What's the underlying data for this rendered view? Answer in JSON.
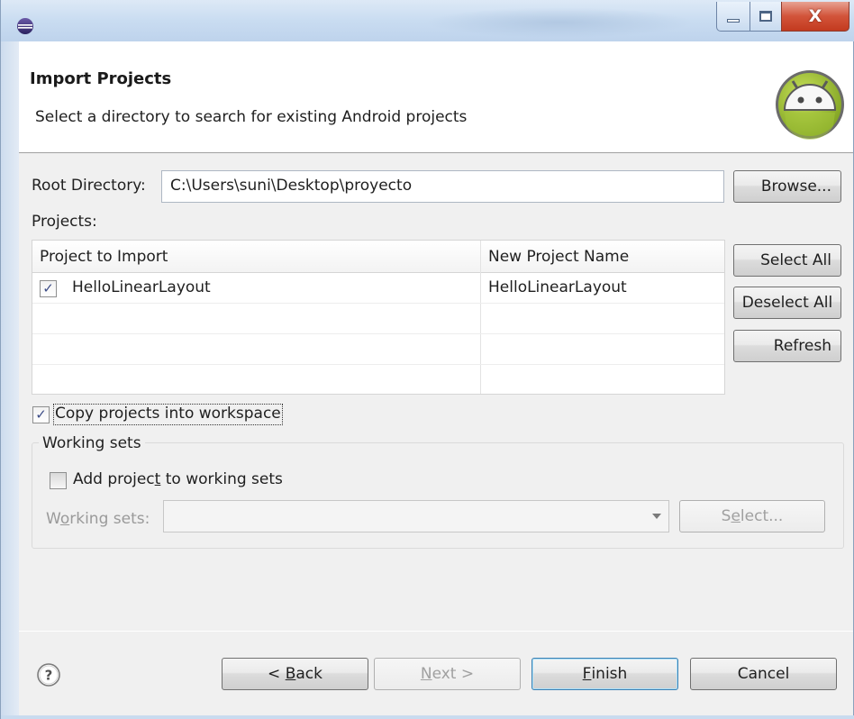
{
  "window": {
    "controls": {
      "minimize_icon": "minimize-icon",
      "maximize_icon": "maximize-icon",
      "close_glyph": "X"
    }
  },
  "header": {
    "title": "Import Projects",
    "description": "Select a directory to search for existing Android projects",
    "logo_icon": "android-logo"
  },
  "root_directory": {
    "label": "Root Directory:",
    "value": "C:\\Users\\suni\\Desktop\\proyecto",
    "browse_label": "Browse..."
  },
  "projects": {
    "label": "Projects:",
    "columns": [
      "Project to Import",
      "New Project Name"
    ],
    "rows": [
      {
        "checked": true,
        "project": "HelloLinearLayout",
        "new_name": "HelloLinearLayout"
      }
    ],
    "buttons": {
      "select_all": "Select All",
      "deselect_all": "Deselect All",
      "refresh": "Refresh"
    }
  },
  "copy_projects": {
    "label": "Copy projects into workspace",
    "checked": true
  },
  "working_sets": {
    "group_label": "Working sets",
    "add_label_pre": "Add projec",
    "add_label_mnemonic": "t",
    "add_label_post": " to working sets",
    "add_checked": false,
    "field_label_pre": "W",
    "field_label_mnemonic": "o",
    "field_label_post": "rking sets:",
    "field_value": "",
    "select_pre": "S",
    "select_mnemonic": "e",
    "select_post": "lect..."
  },
  "footer": {
    "help_icon": "help-icon",
    "back_pre": "< ",
    "back_mnemonic": "B",
    "back_post": "ack",
    "next_pre": "",
    "next_mnemonic": "N",
    "next_post": "ext >",
    "finish_mnemonic": "F",
    "finish_post": "inish",
    "cancel": "Cancel"
  },
  "colors": {
    "titlebar": "#c9dcf1",
    "close_button": "#c33a1f",
    "android_green": "#a4c639",
    "dialog_bg": "#f0f0f0",
    "default_button_border": "#3c7fb1"
  }
}
